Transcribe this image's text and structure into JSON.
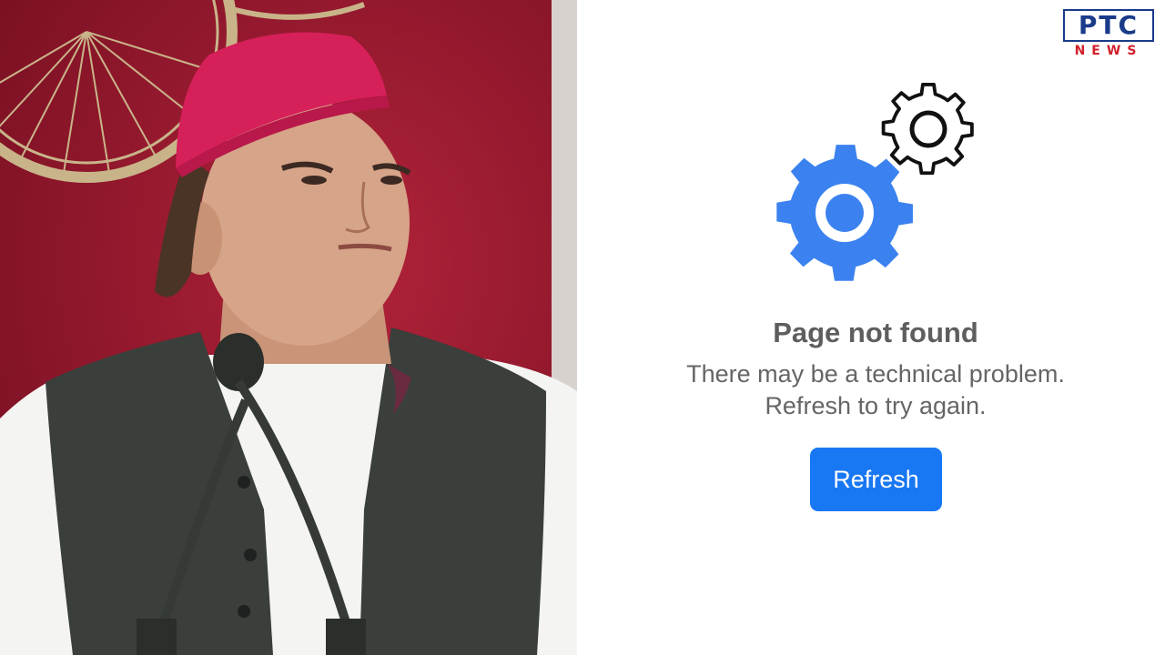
{
  "logo": {
    "text": "PTC",
    "subtext": "NEWS"
  },
  "error": {
    "title": "Page not found",
    "message_line1": "There may be a technical problem.",
    "message_line2": "Refresh to try again.",
    "button_label": "Refresh"
  },
  "icons": {
    "small_gear": "gear-icon-outline",
    "large_gear": "gear-icon-blue"
  },
  "colors": {
    "button": "#1877f2",
    "gear_blue": "#3b82f0",
    "backdrop_red": "#9a1a2e",
    "cap_pink": "#d6205a"
  }
}
